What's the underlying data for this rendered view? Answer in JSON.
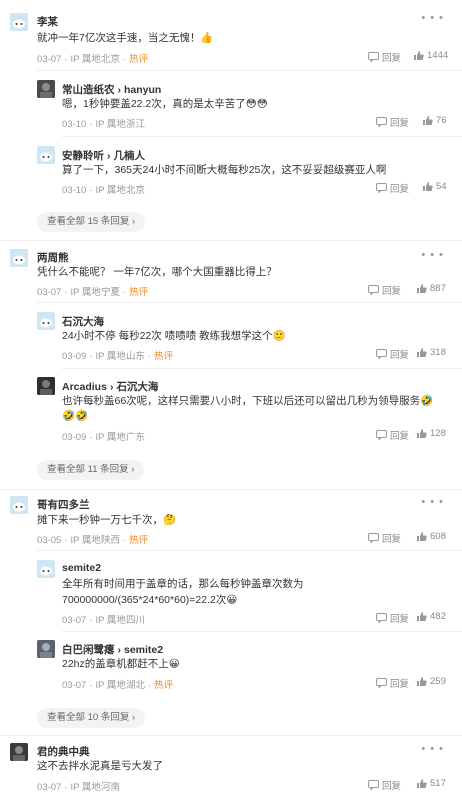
{
  "labels": {
    "ip_prefix": "IP 属地",
    "hot": "热评",
    "reply": "回复"
  },
  "threads": [
    {
      "user": "李某",
      "text": "就冲一年7亿次这手速，当之无愧！👍",
      "date": "03-07",
      "location": "北京",
      "hot": true,
      "likes": "1444",
      "replies": [
        {
          "user": "常山造纸农",
          "reply_to": "hanyun",
          "text": "嗯，1秒钟要盖22.2次，真的是太辛苦了😳😳",
          "date": "03-10",
          "location": "浙江",
          "hot": false,
          "likes": "76"
        },
        {
          "user": "安静聆听",
          "reply_to": "几楠人",
          "text": "算了一下，365天24小时不间断大概每秒25次，这不妥妥超级赛亚人啊",
          "date": "03-10",
          "location": "北京",
          "hot": false,
          "likes": "54"
        }
      ],
      "view_more": "查看全部 15 条回复 ›"
    },
    {
      "user": "两周熊",
      "text": "凭什么不能呢？ 一年7亿次，哪个大国重器比得上？",
      "date": "03-07",
      "location": "宁夏",
      "hot": true,
      "likes": "887",
      "replies": [
        {
          "user": "石沉大海",
          "reply_to": "",
          "text": "24小时不停 每秒22次 啧啧啧 教练我想学这个🙂",
          "date": "03-09",
          "location": "山东",
          "hot": true,
          "likes": "318"
        },
        {
          "user": "Arcadius",
          "reply_to": "石沉大海",
          "text": "也许每秒盖66次呢，这样只需要八小时，下班以后还可以留出几秒为领导服务🤣",
          "text2": "🤣🤣",
          "date": "03-09",
          "location": "广东",
          "hot": false,
          "likes": "128"
        }
      ],
      "view_more": "查看全部 11 条回复 ›"
    },
    {
      "user": "哥有四多兰",
      "text": "摊下来一秒钟一万七千次，🤔",
      "date": "03-05",
      "location": "陕西",
      "hot": true,
      "likes": "608",
      "replies": [
        {
          "user": "semite2",
          "reply_to": "",
          "text": "全年所有时间用于盖章的话，那么每秒钟盖章次数为",
          "text2": "700000000/(365*24*60*60)=22.2次😀",
          "date": "03-07",
          "location": "四川",
          "hot": false,
          "likes": "482"
        },
        {
          "user": "白巴闲鹭瘪",
          "reply_to": "semite2",
          "text": "22hz的盖章机都赶不上😀",
          "date": "03-07",
          "location": "湖北",
          "hot": true,
          "likes": "259"
        }
      ],
      "view_more": "查看全部 10 条回复 ›"
    },
    {
      "user": "君的典中典",
      "text": "这不去拌水泥真是亏大发了",
      "date": "03-07",
      "location": "河南",
      "hot": false,
      "likes": "517",
      "replies": []
    }
  ]
}
